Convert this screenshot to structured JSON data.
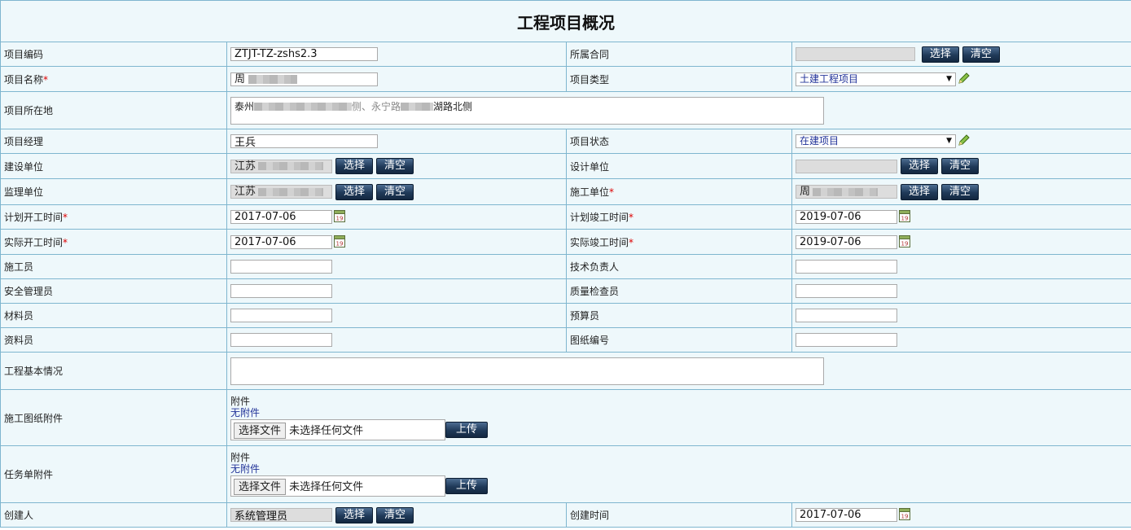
{
  "page": {
    "title": "工程项目概况"
  },
  "buttons": {
    "select": "选择",
    "clear": "清空",
    "upload": "上传"
  },
  "fields": {
    "project_code": {
      "label": "项目编码",
      "value": "ZTJT-TZ-zshs2.3"
    },
    "contract": {
      "label": "所属合同",
      "value": ""
    },
    "project_name": {
      "label": "项目名称",
      "value": "周",
      "required": "*"
    },
    "project_type": {
      "label": "项目类型",
      "value": "土建工程项目"
    },
    "location": {
      "label": "项目所在地",
      "value_start": "泰州",
      "value_end": "湖路北侧",
      "value_mid": "侧、永宁路"
    },
    "manager": {
      "label": "项目经理",
      "value": "王兵"
    },
    "status": {
      "label": "项目状态",
      "value": "在建项目"
    },
    "build_unit": {
      "label": "建设单位",
      "value": "江苏"
    },
    "design_unit": {
      "label": "设计单位",
      "value": ""
    },
    "supervise_unit": {
      "label": "监理单位",
      "value": "江苏"
    },
    "construct_unit": {
      "label": "施工单位",
      "value": "周",
      "required": "*"
    },
    "plan_start": {
      "label": "计划开工时间",
      "value": "2017-07-06",
      "required": "*"
    },
    "plan_end": {
      "label": "计划竣工时间",
      "value": "2019-07-06",
      "required": "*"
    },
    "actual_start": {
      "label": "实际开工时间",
      "value": "2017-07-06",
      "required": "*"
    },
    "actual_end": {
      "label": "实际竣工时间",
      "value": "2019-07-06",
      "required": "*"
    },
    "builder": {
      "label": "施工员",
      "value": ""
    },
    "tech_lead": {
      "label": "技术负责人",
      "value": ""
    },
    "safety": {
      "label": "安全管理员",
      "value": ""
    },
    "quality": {
      "label": "质量检查员",
      "value": ""
    },
    "material": {
      "label": "材料员",
      "value": ""
    },
    "budget": {
      "label": "预算员",
      "value": ""
    },
    "docs": {
      "label": "资料员",
      "value": ""
    },
    "drawing_no": {
      "label": "图纸编号",
      "value": ""
    },
    "basic_info": {
      "label": "工程基本情况",
      "value": ""
    },
    "drawing_attach": {
      "label": "施工图纸附件",
      "att_label": "附件",
      "att_none": "无附件",
      "file_btn": "选择文件",
      "file_status": "未选择任何文件"
    },
    "task_attach": {
      "label": "任务单附件",
      "att_label": "附件",
      "att_none": "无附件",
      "file_btn": "选择文件",
      "file_status": "未选择任何文件"
    },
    "creator": {
      "label": "创建人",
      "value": "系统管理员"
    },
    "created_at": {
      "label": "创建时间",
      "value": "2017-07-06"
    }
  },
  "icons": {
    "calendar": "calendar-icon",
    "edit": "pencil-icon",
    "dropdown": "chevron-down-icon"
  },
  "colors": {
    "header_bg": "#a7d5e2",
    "cell_bg": "#eef8fb",
    "border": "#7fb6cf",
    "button": "#1f3958",
    "required": "#dd0000"
  }
}
